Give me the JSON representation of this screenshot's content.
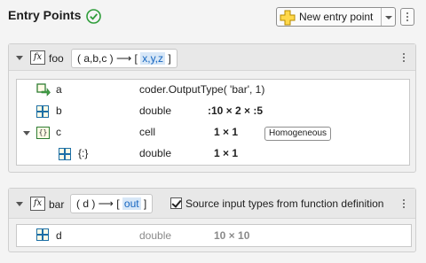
{
  "header": {
    "title": "Entry Points",
    "new_entry_label": "New entry point"
  },
  "functions": [
    {
      "name": "foo",
      "signature": {
        "open": "( a,b,c ) ⟶ [",
        "outputs": "x,y,z",
        "close": "]"
      },
      "rows": [
        {
          "name": "a",
          "type": "coder.OutputType( 'bar', 1)",
          "size": ""
        },
        {
          "name": "b",
          "type": "double",
          "size": ":10 × 2 × :5"
        },
        {
          "name": "c",
          "type": "cell",
          "size": "1 × 1",
          "badge": "Homogeneous"
        },
        {
          "name": "{:}",
          "type": "double",
          "size": "1 × 1"
        }
      ]
    },
    {
      "name": "bar",
      "signature": {
        "open": "( d ) ⟶ [",
        "outputs": "out",
        "close": "]"
      },
      "source_checkbox_label": "Source input types from function definition",
      "rows": [
        {
          "name": "d",
          "type": "double",
          "size": "10 × 10"
        }
      ]
    }
  ],
  "colors": {
    "check_green": "#2e9d3a",
    "highlight_blue": "#1565c0"
  }
}
